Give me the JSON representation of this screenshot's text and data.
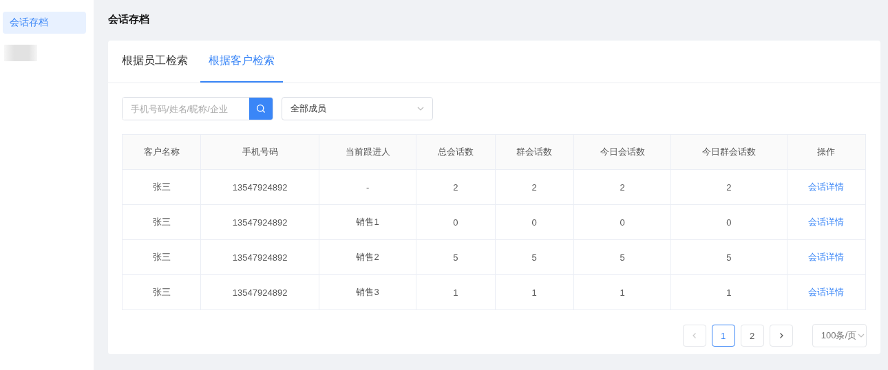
{
  "sidebar": {
    "items": [
      {
        "label": "会话存档",
        "selected": true
      }
    ]
  },
  "page_title": "会话存档",
  "tabs": [
    {
      "label": "根据员工检索",
      "selected": false
    },
    {
      "label": "根据客户检索",
      "selected": true
    }
  ],
  "search": {
    "placeholder": "手机号码/姓名/昵称/企业"
  },
  "member_select": {
    "value": "全部成员"
  },
  "table": {
    "columns": [
      "客户名称",
      "手机号码",
      "当前跟进人",
      "总会话数",
      "群会话数",
      "今日会话数",
      "今日群会话数",
      "操作"
    ],
    "rows": [
      {
        "cells": [
          "张三",
          "13547924892",
          "-",
          "2",
          "2",
          "2",
          "2"
        ],
        "action": "会话详情"
      },
      {
        "cells": [
          "张三",
          "13547924892",
          "销售1",
          "0",
          "0",
          "0",
          "0"
        ],
        "action": "会话详情"
      },
      {
        "cells": [
          "张三",
          "13547924892",
          "销售2",
          "5",
          "5",
          "5",
          "5"
        ],
        "action": "会话详情"
      },
      {
        "cells": [
          "张三",
          "13547924892",
          "销售3",
          "1",
          "1",
          "1",
          "1"
        ],
        "action": "会话详情"
      }
    ]
  },
  "pagination": {
    "prev_disabled": true,
    "pages": [
      {
        "label": "1",
        "selected": true
      },
      {
        "label": "2",
        "selected": false
      }
    ],
    "page_size": "100条/页"
  }
}
